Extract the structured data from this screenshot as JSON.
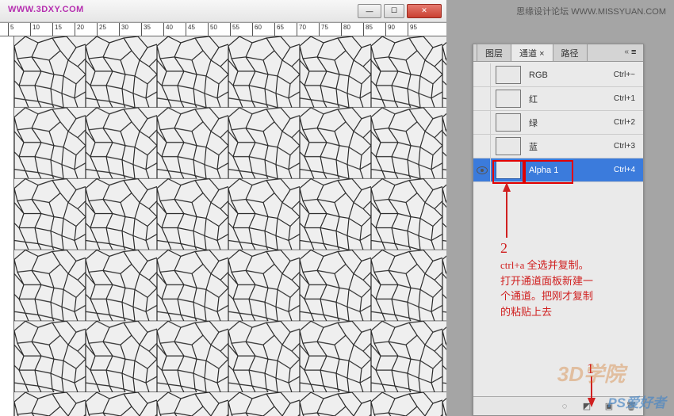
{
  "watermarks": {
    "top_left": "WWW.3DXY.COM",
    "top_right_label": "思缘设计论坛 WWW.MISSYUAN.COM",
    "bottom_right": "PS爱好者",
    "mid_right": "3D学院"
  },
  "ruler": {
    "ticks": [
      "5",
      "10",
      "15",
      "20",
      "25",
      "30",
      "35",
      "40",
      "45",
      "50",
      "55",
      "60",
      "65",
      "70",
      "75",
      "80",
      "85",
      "90",
      "95"
    ]
  },
  "panel": {
    "tabs": {
      "layers": "图层",
      "channels": "通道",
      "paths": "路径",
      "close": "×"
    },
    "channels": [
      {
        "name": "RGB",
        "shortcut": "Ctrl+~",
        "selected": false,
        "visible": false
      },
      {
        "name": "红",
        "shortcut": "Ctrl+1",
        "selected": false,
        "visible": false
      },
      {
        "name": "绿",
        "shortcut": "Ctrl+2",
        "selected": false,
        "visible": false
      },
      {
        "name": "蓝",
        "shortcut": "Ctrl+3",
        "selected": false,
        "visible": false
      },
      {
        "name": "Alpha 1",
        "shortcut": "Ctrl+4",
        "selected": true,
        "visible": true
      }
    ],
    "footer_icons": {
      "selection": "circle-dashed-icon",
      "mask": "mask-icon",
      "new": "new-page-icon",
      "trash": "trash-icon"
    }
  },
  "annotations": {
    "num2": "2",
    "instruction": "ctrl+a 全选并复制。打开通道面板新建一个通道。把刚才复制的粘贴上去",
    "num1": "1"
  }
}
